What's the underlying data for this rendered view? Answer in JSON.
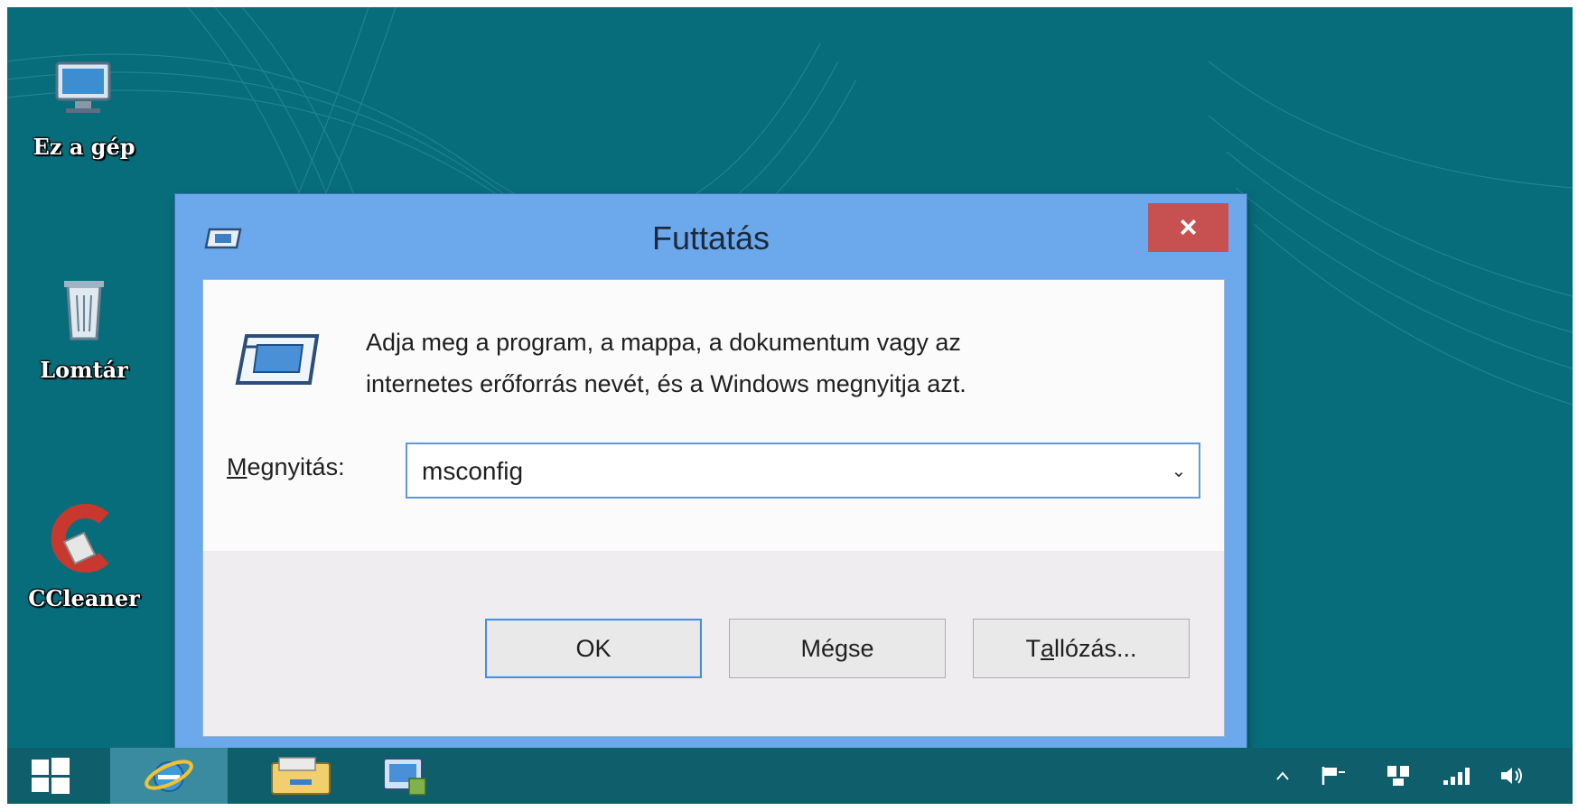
{
  "desktop": {
    "icons": [
      {
        "label": "Ez a gép",
        "icon": "computer-icon"
      },
      {
        "label": "Lomtár",
        "icon": "recycle-bin-icon"
      },
      {
        "label": "CCleaner",
        "icon": "ccleaner-icon"
      }
    ]
  },
  "dialog": {
    "title": "Futtatás",
    "close_label": "×",
    "description_line1": "Adja meg a program, a mappa, a dokumentum vagy az",
    "description_line2": "internetes erőforrás nevét, és a Windows megnyitja azt.",
    "open_label_first": "M",
    "open_label_rest": "egnyitás:",
    "open_value": "msconfig",
    "dropdown_glyph": "⌄",
    "ok_label": "OK",
    "cancel_label": "Mégse",
    "browse_label_pre": "T",
    "browse_label_u": "a",
    "browse_label_post": "llózás..."
  },
  "taskbar": {
    "pinned": [
      {
        "icon": "windows-start-icon"
      },
      {
        "icon": "internet-explorer-icon"
      },
      {
        "icon": "file-explorer-icon"
      },
      {
        "icon": "control-panel-icon"
      }
    ],
    "tray": [
      {
        "icon": "show-hidden-icons-icon"
      },
      {
        "icon": "action-center-flag-icon"
      },
      {
        "icon": "network-icon"
      },
      {
        "icon": "signal-icon"
      },
      {
        "icon": "volume-icon"
      }
    ]
  },
  "colors": {
    "desktop": "#086d7b",
    "dialog_frame": "#6ba8ec",
    "close_button": "#c75050",
    "taskbar": "#0e5e6b"
  }
}
